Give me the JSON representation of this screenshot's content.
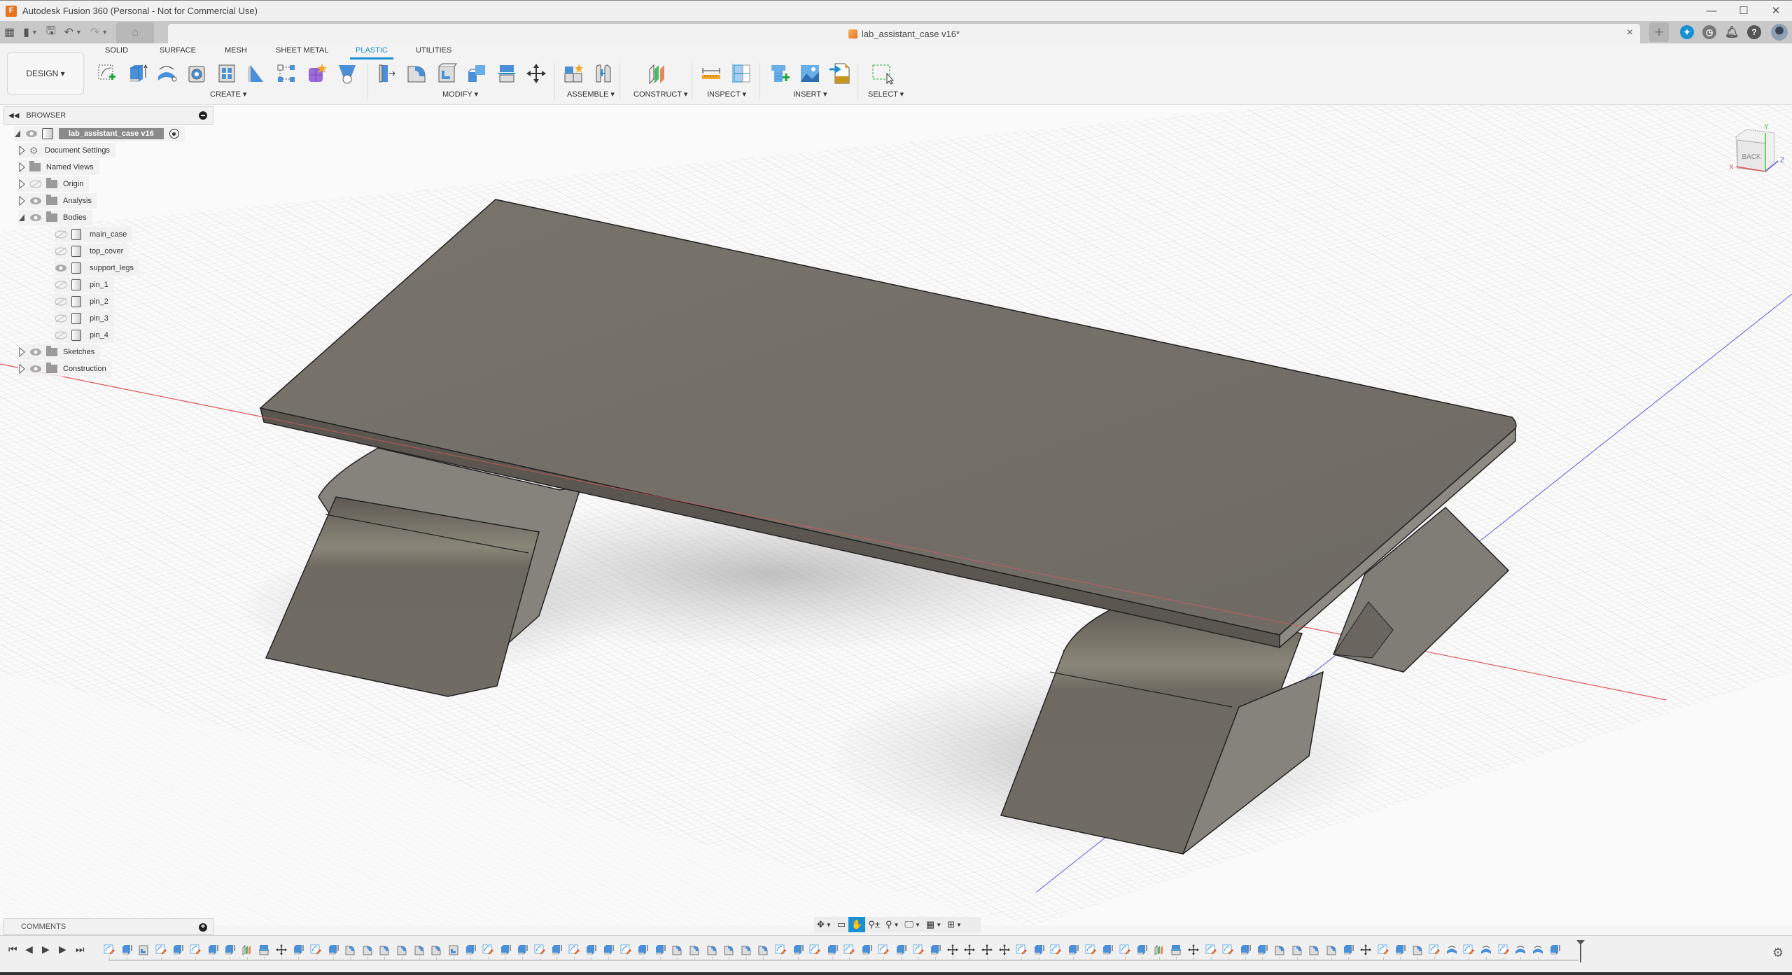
{
  "window": {
    "title": "Autodesk Fusion 360 (Personal - Not for Commercial Use)",
    "logo_letter": "F",
    "controls": [
      "minimize",
      "maximize",
      "close"
    ]
  },
  "quick_access": {
    "items": [
      "apps-grid-icon",
      "file-icon",
      "save-icon",
      "undo-icon",
      "redo-icon",
      "home-icon"
    ]
  },
  "document_tab": {
    "name": "lab_assistant_case v16*",
    "close_label": "×"
  },
  "top_right": {
    "new_tab": "+",
    "icons": [
      "extensions-icon",
      "job-status-icon",
      "notifications-icon",
      "help-icon",
      "profile-avatar"
    ]
  },
  "ribbon": {
    "workspace": "DESIGN ▾",
    "tabs": [
      "SOLID",
      "SURFACE",
      "MESH",
      "SHEET METAL",
      "PLASTIC",
      "UTILITIES"
    ],
    "active_tab": "PLASTIC",
    "groups": [
      {
        "label": "CREATE ▾",
        "tools": [
          "create-sketch",
          "extrude",
          "revolve",
          "boss",
          "rib-web",
          "snap-fit",
          "sketch-pattern",
          "form",
          "lip-groove"
        ]
      },
      {
        "label": "MODIFY ▾",
        "tools": [
          "press-pull",
          "fillet",
          "shell",
          "combine",
          "split-face",
          "move-copy"
        ]
      },
      {
        "label": "ASSEMBLE ▾",
        "tools": [
          "new-component",
          "joint"
        ]
      },
      {
        "label": "CONSTRUCT ▾",
        "tools": [
          "offset-plane"
        ]
      },
      {
        "label": "INSPECT ▾",
        "tools": [
          "measure",
          "section-analysis"
        ]
      },
      {
        "label": "INSERT ▾",
        "tools": [
          "insert-fastener",
          "insert-canvas",
          "insert-svg"
        ]
      },
      {
        "label": "SELECT ▾",
        "tools": [
          "window-select"
        ]
      }
    ]
  },
  "browser": {
    "title": "BROWSER",
    "root": {
      "label": "lab_assistant_case v16",
      "visible": true
    },
    "items": [
      {
        "label": "Document Settings",
        "type": "settings",
        "level": 1,
        "expanded": false,
        "visible": null
      },
      {
        "label": "Named Views",
        "type": "folder",
        "level": 1,
        "expanded": false,
        "visible": null
      },
      {
        "label": "Origin",
        "type": "folder",
        "level": 1,
        "expanded": false,
        "visible": false
      },
      {
        "label": "Analysis",
        "type": "folder",
        "level": 1,
        "expanded": false,
        "visible": true
      },
      {
        "label": "Bodies",
        "type": "folder",
        "level": 1,
        "expanded": true,
        "visible": true
      },
      {
        "label": "main_case",
        "type": "body",
        "level": 2,
        "visible": false
      },
      {
        "label": "top_cover",
        "type": "body",
        "level": 2,
        "visible": false
      },
      {
        "label": "support_legs",
        "type": "body",
        "level": 2,
        "visible": true
      },
      {
        "label": "pin_1",
        "type": "body",
        "level": 2,
        "visible": false
      },
      {
        "label": "pin_2",
        "type": "body",
        "level": 2,
        "visible": false
      },
      {
        "label": "pin_3",
        "type": "body",
        "level": 2,
        "visible": false
      },
      {
        "label": "pin_4",
        "type": "body",
        "level": 2,
        "visible": false
      },
      {
        "label": "Sketches",
        "type": "folder",
        "level": 1,
        "expanded": false,
        "visible": true
      },
      {
        "label": "Construction",
        "type": "folder",
        "level": 1,
        "expanded": false,
        "visible": true
      }
    ]
  },
  "viewcube": {
    "face": "BACK",
    "axes": [
      "X",
      "Y",
      "Z"
    ]
  },
  "comments": {
    "title": "COMMENTS"
  },
  "nav_toolbar": {
    "items": [
      "orbit",
      "look-at",
      "pan",
      "zoom",
      "fit",
      "display-settings",
      "grid-snaps",
      "viewports"
    ],
    "active": "pan"
  },
  "timeline": {
    "controls": [
      "go-to-start",
      "step-back",
      "play",
      "step-forward",
      "go-to-end"
    ],
    "features": [
      "s",
      "e",
      "sh",
      "s",
      "e",
      "s",
      "e",
      "e",
      "c",
      "cb",
      "m",
      "e",
      "s",
      "e",
      "f",
      "f",
      "f",
      "f",
      "f",
      "f",
      "sh",
      "e",
      "s",
      "e",
      "e",
      "s",
      "e",
      "s",
      "e",
      "e",
      "s",
      "e",
      "e",
      "f",
      "f",
      "f",
      "f",
      "f",
      "f",
      "s",
      "e",
      "s",
      "e",
      "s",
      "e",
      "s",
      "e",
      "s",
      "e",
      "m",
      "m",
      "m",
      "m",
      "s",
      "e",
      "s",
      "e",
      "s",
      "e",
      "s",
      "e",
      "c",
      "cb",
      "m",
      "s",
      "s",
      "e",
      "e",
      "f",
      "f",
      "f",
      "f",
      "e",
      "m",
      "s",
      "e",
      "f",
      "s",
      "r",
      "s",
      "r",
      "s",
      "r",
      "r",
      "e"
    ],
    "legend": {
      "s": "sketch",
      "e": "extrude",
      "sh": "shell",
      "c": "construction-plane",
      "cb": "combine",
      "m": "move",
      "f": "fillet",
      "r": "revolve"
    }
  },
  "colors": {
    "accent": "#1a8fd1",
    "body_top": "#75716a",
    "body_side": "#5f5b54",
    "leg_front": "#6f6b63",
    "leg_side": "#87847e",
    "axis_x": "#e05a5a",
    "axis_z": "#5a5ae0",
    "grid": "#d6d6d6"
  }
}
